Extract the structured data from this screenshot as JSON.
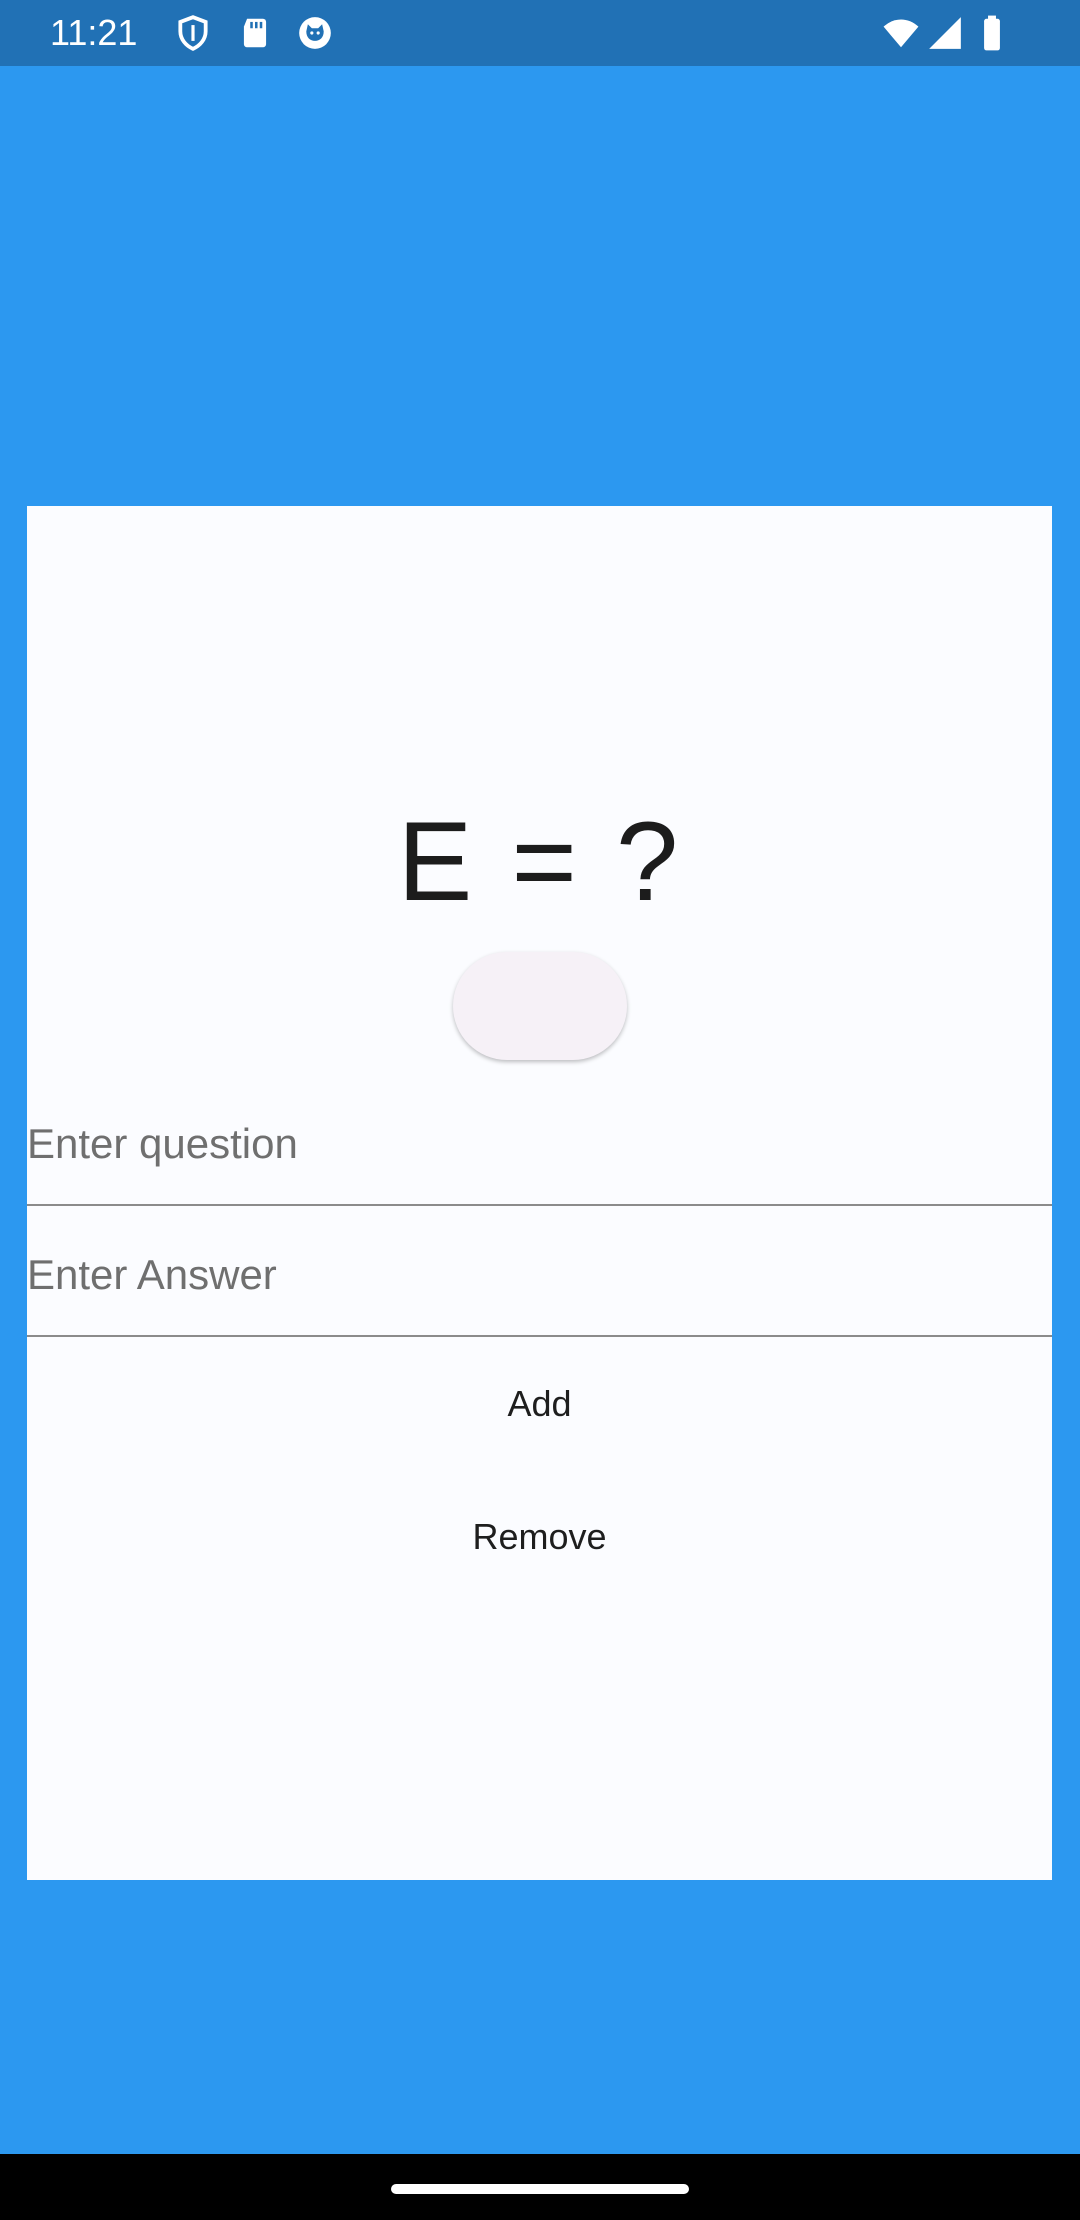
{
  "status_bar": {
    "time": "11:21",
    "icons": [
      "shield-icon",
      "sd-card-icon",
      "cat-face-icon",
      "wifi-icon",
      "cellular-signal-icon",
      "battery-icon"
    ]
  },
  "colors": {
    "background": "#2c98f0",
    "status_bar": "#2171b5",
    "card": "#fbfcff",
    "pill_button": "#f6f1f7"
  },
  "card": {
    "equation": "E = ?",
    "question_input": {
      "placeholder": "Enter question",
      "value": ""
    },
    "answer_input": {
      "placeholder": "Enter Answer",
      "value": ""
    },
    "add_label": "Add",
    "remove_label": "Remove"
  }
}
